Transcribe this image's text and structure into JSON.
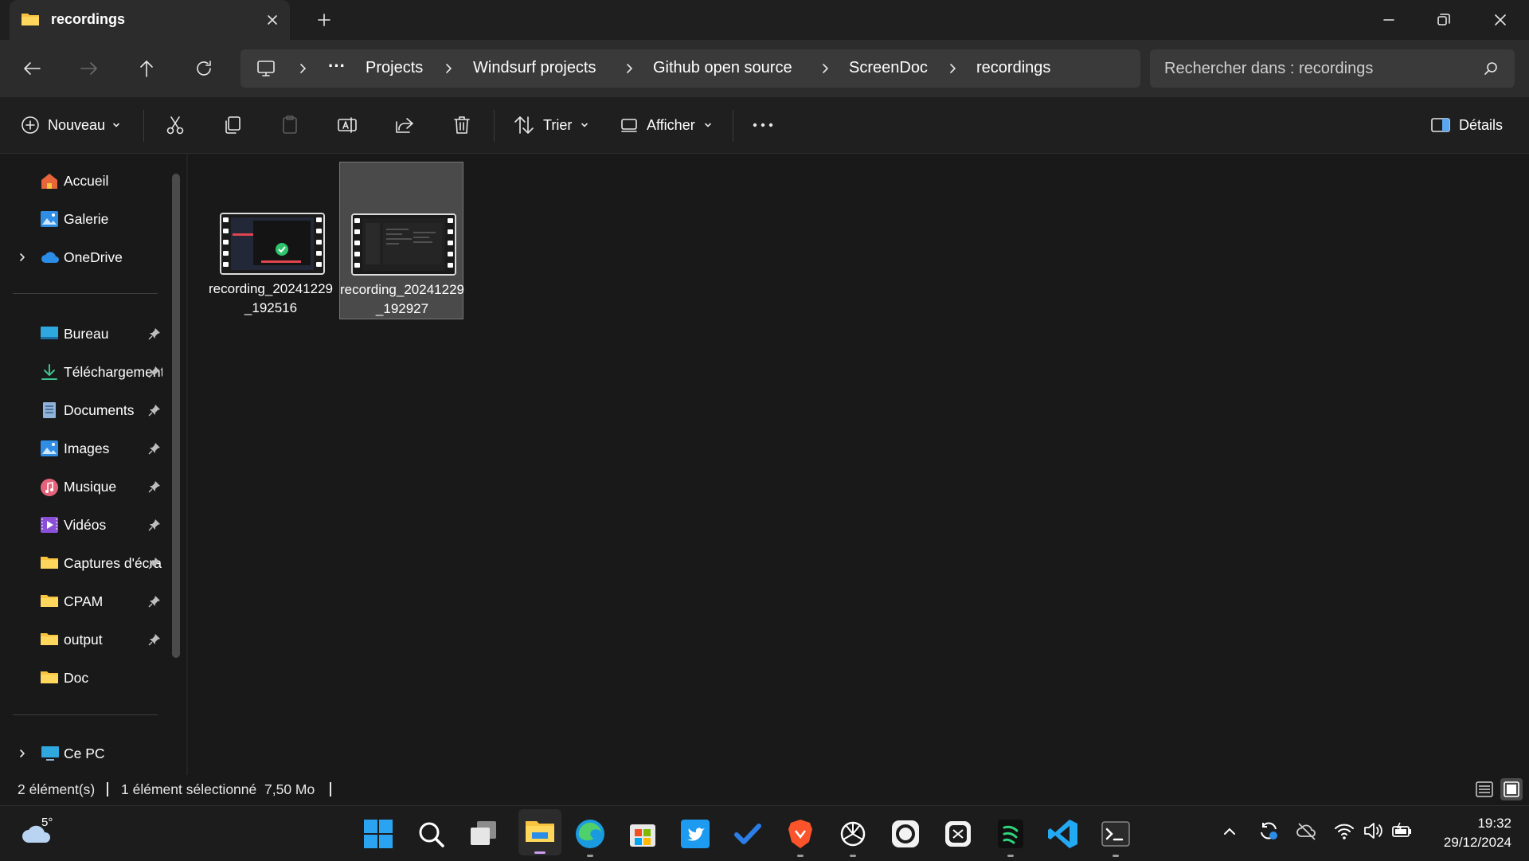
{
  "window": {
    "tab_title": "recordings",
    "new_tab_symbol": "+"
  },
  "breadcrumb": {
    "overflow": "···",
    "items": [
      "Projects",
      "Windsurf projects",
      "Github open source",
      "ScreenDoc",
      "recordings"
    ]
  },
  "search": {
    "placeholder": "Rechercher dans : recordings"
  },
  "commands": {
    "new_label": "Nouveau",
    "sort_label": "Trier",
    "view_label": "Afficher",
    "details_label": "Détails"
  },
  "sidebar": {
    "top_items": [
      {
        "label": "Accueil",
        "icon": "home-icon"
      },
      {
        "label": "Galerie",
        "icon": "gallery-icon"
      },
      {
        "label": "OneDrive",
        "icon": "cloud-icon"
      }
    ],
    "pinned_items": [
      {
        "label": "Bureau",
        "icon": "desktop-folder-icon"
      },
      {
        "label": "Téléchargements",
        "icon": "download-icon"
      },
      {
        "label": "Documents",
        "icon": "documents-icon"
      },
      {
        "label": "Images",
        "icon": "pictures-icon"
      },
      {
        "label": "Musique",
        "icon": "music-icon"
      },
      {
        "label": "Vidéos",
        "icon": "videos-icon"
      },
      {
        "label": "Captures d'écran",
        "icon": "folder-icon"
      },
      {
        "label": "CPAM",
        "icon": "folder-icon"
      },
      {
        "label": "output",
        "icon": "folder-icon"
      },
      {
        "label": "Doc",
        "icon": "folder-icon"
      }
    ],
    "bottom_items": [
      {
        "label": "Ce PC",
        "icon": "pc-icon"
      }
    ]
  },
  "files": [
    {
      "name": "recording_20241229_192516",
      "selected": false
    },
    {
      "name": "recording_20241229_192927",
      "selected": true
    }
  ],
  "status": {
    "count": "2 élément(s)",
    "selection": "1 élément sélectionné",
    "size": "7,50 Mo"
  },
  "taskbar": {
    "weather_temp": "5°",
    "time": "19:32",
    "date": "29/12/2024"
  },
  "colors": {
    "background": "#191919",
    "accent": "#0a7ad6",
    "folder": "#f8c33f"
  }
}
